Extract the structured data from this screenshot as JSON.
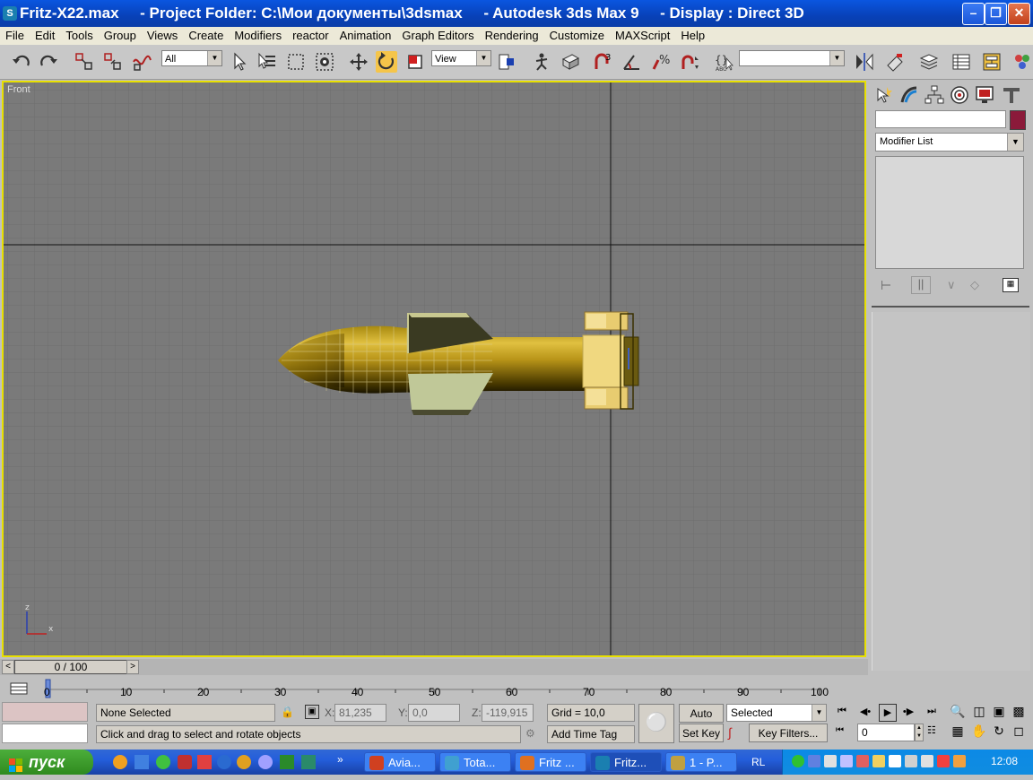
{
  "window": {
    "title": "Fritz-X22.max     - Project Folder: C:\\Мои документы\\3dsmax     - Autodesk 3ds Max 9     - Display : Direct 3D",
    "app_icon": "3ds-max-icon",
    "buttons": [
      "minimize",
      "restore",
      "close"
    ]
  },
  "menu": [
    "File",
    "Edit",
    "Tools",
    "Group",
    "Views",
    "Create",
    "Modifiers",
    "reactor",
    "Animation",
    "Graph Editors",
    "Rendering",
    "Customize",
    "MAXScript",
    "Help"
  ],
  "toolbar": {
    "selection_filter": "All",
    "ref_coord": "View",
    "named_selection": "",
    "snap_label": "3",
    "active_tool": "select-and-rotate"
  },
  "viewport": {
    "label": "Front",
    "axis_z": "z",
    "axis_x": "x",
    "border_color": "#e8e000",
    "bg_color": "#7a7a7a"
  },
  "command_panel": {
    "name_field": "",
    "color_swatch": "#8b1a3a",
    "modifier_list": "Modifier List",
    "tabs": [
      "create",
      "modify",
      "hierarchy",
      "motion",
      "display",
      "utilities"
    ]
  },
  "timeline": {
    "frame_display": "0 / 100",
    "ticks": [
      "0",
      "10",
      "20",
      "30",
      "40",
      "50",
      "60",
      "70",
      "80",
      "90",
      "100"
    ]
  },
  "status": {
    "selection": "None Selected",
    "prompt": "Click and drag to select and rotate objects",
    "x_label": "X:",
    "x_value": "81,235",
    "y_label": "Y:",
    "y_value": "0,0",
    "z_label": "Z:",
    "z_value": "-119,915",
    "grid": "Grid = 10,0",
    "add_time_tag": "Add Time Tag",
    "auto_key": "Auto Key",
    "set_key": "Set Key",
    "key_mode": "Selected",
    "key_filters": "Key Filters...",
    "current_frame": "0"
  },
  "taskbar": {
    "start": "пуск",
    "tasks": [
      {
        "label": "Avia...",
        "icon_color": "#d04020"
      },
      {
        "label": "Tota...",
        "icon_color": "#40a0d0"
      },
      {
        "label": "Fritz ...",
        "icon_color": "#e07020"
      },
      {
        "label": "Fritz...",
        "icon_color": "#1a7fb0"
      },
      {
        "label": "1 - P...",
        "icon_color": "#c0a040"
      }
    ],
    "lang": "RL",
    "clock": "12:08"
  }
}
